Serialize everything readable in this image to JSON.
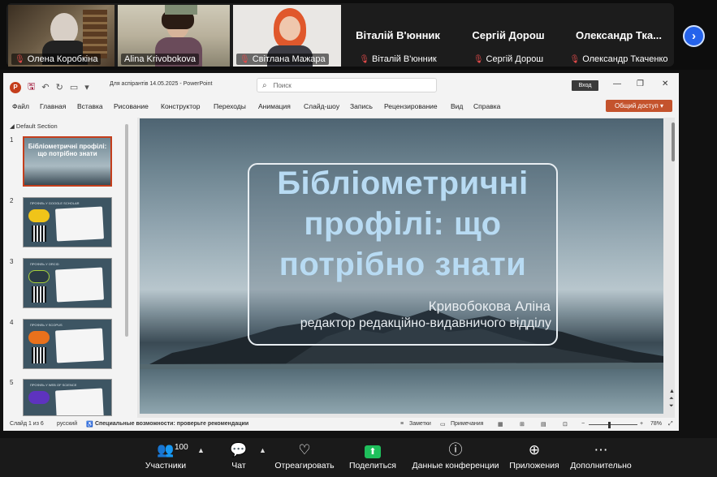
{
  "participants_strip": {
    "tiles": [
      {
        "name": "Олена Коробкіна",
        "muted": true,
        "video": true
      },
      {
        "name": "Alina Krivobokova",
        "muted": false,
        "video": true
      },
      {
        "name": "Світлана Мажара",
        "muted": true,
        "video": true
      },
      {
        "name": "Віталій В'юнник",
        "muted": true,
        "video": false
      },
      {
        "name": "Сергій Дорош",
        "muted": true,
        "video": false
      },
      {
        "name": "Олександр Ткаченко",
        "display_name": "Олександр Тка...",
        "muted": true,
        "video": false
      }
    ]
  },
  "ppt": {
    "doc_title": "Для аспірантів 14.05.2025  -  PowerPoint",
    "search_placeholder": "Поиск",
    "signin_label": "Вход",
    "menu": [
      "Файл",
      "Главная",
      "Вставка",
      "Рисование",
      "Конструктор",
      "Переходы",
      "Анимация",
      "Слайд-шоу",
      "Запись",
      "Рецензирование",
      "Вид",
      "Справка"
    ],
    "share_label": "Общий доступ",
    "section_label": "Default Section",
    "thumbnails": [
      {
        "num": "1",
        "title": "Бібліометричні профілі: що потрібно знати"
      },
      {
        "num": "2",
        "head": "ПРОФІЛЬ У GOOGLE SCHOLAR",
        "logo_color": "#f0c419"
      },
      {
        "num": "3",
        "head": "ПРОФІЛЬ У ORCID",
        "logo_color": "#a6ce39"
      },
      {
        "num": "4",
        "head": "ПРОФІЛЬ У SCOPUS",
        "logo_color": "#e9711c"
      },
      {
        "num": "5",
        "head": "ПРОФІЛЬ У WEB OF SCIENCE",
        "logo_color": "#5e33bf"
      }
    ],
    "slide": {
      "title": "Бібліометричні профілі: що потрібно знати",
      "author": "Кривобокова Аліна",
      "role": "редактор редакційно-видавничого відділу"
    },
    "status": {
      "slide_info": "Слайд 1 из 6",
      "language": "русский",
      "accessibility": "Специальные возможности: проверьте рекомендации",
      "notes": "Заметки",
      "comments": "Примечания",
      "zoom": "78%"
    }
  },
  "zoom_toolbar": {
    "participants_count": "100",
    "items": [
      {
        "label": "Участники",
        "icon": "people-icon"
      },
      {
        "label": "Чат",
        "icon": "chat-icon"
      },
      {
        "label": "Отреагировать",
        "icon": "heart-icon"
      },
      {
        "label": "Поделиться",
        "icon": "share-screen-icon"
      },
      {
        "label": "Данные конференции",
        "icon": "info-icon"
      },
      {
        "label": "Приложения",
        "icon": "apps-icon"
      },
      {
        "label": "Дополнительно",
        "icon": "more-icon"
      }
    ]
  },
  "colors": {
    "share_green": "#1fbf5c",
    "ppt_accent": "#c43e1c",
    "slide_title": "#b8dbf3",
    "next_button": "#2563eb"
  }
}
